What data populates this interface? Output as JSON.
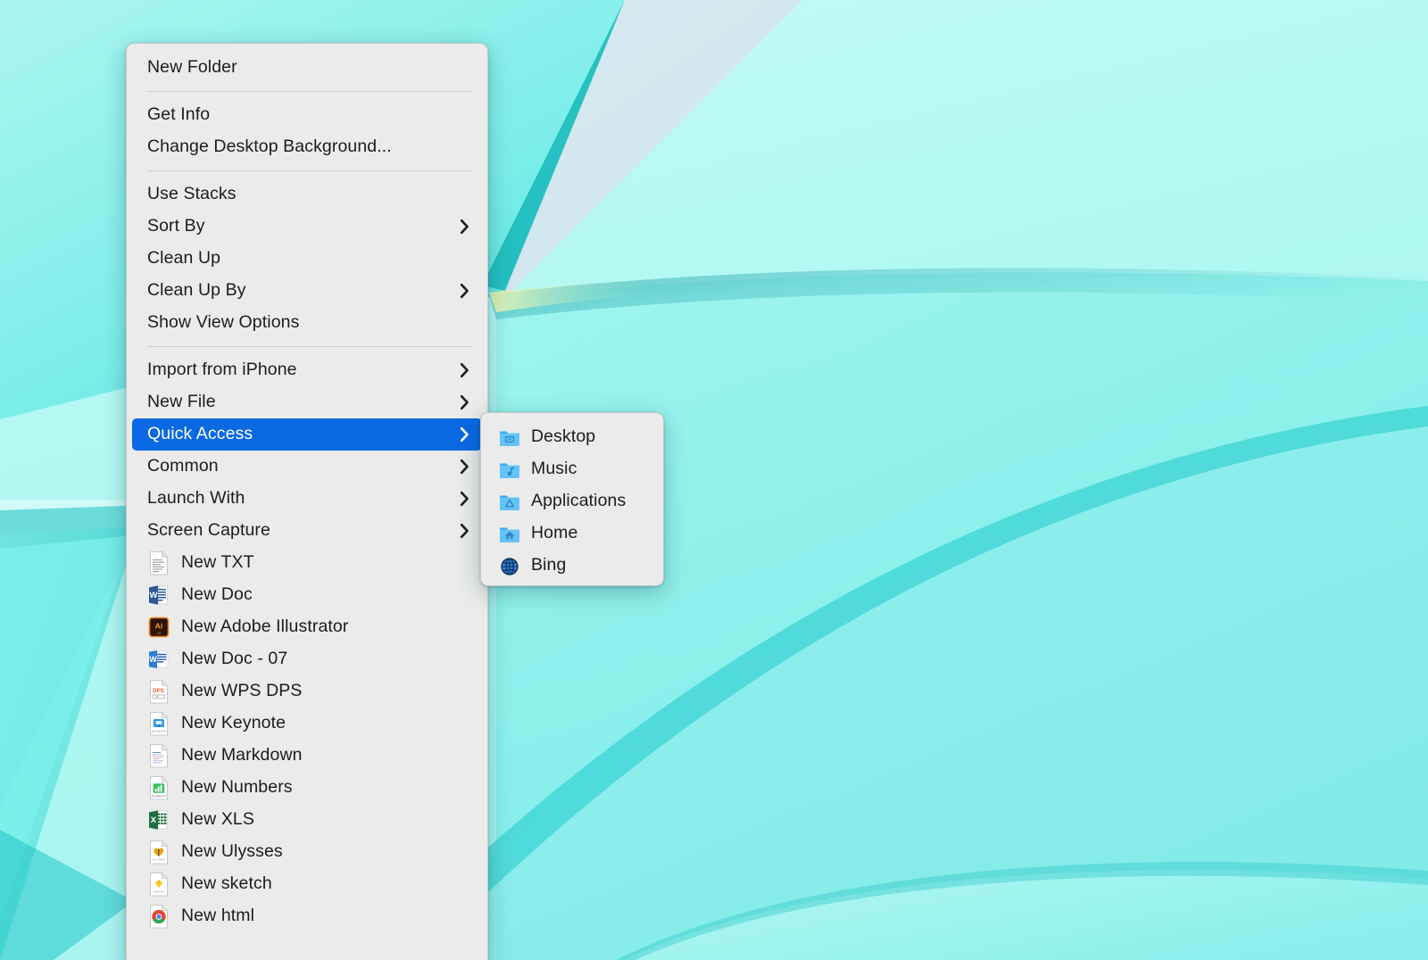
{
  "desktop": {
    "wallpaper_name": "abstract-turquoise-wallpaper",
    "colors": {
      "cyan_light": "#c2fbf5",
      "cyan_mid": "#9df3ec",
      "teal": "#2fd4cd",
      "teal_deep": "#11b8b8",
      "pale_blue": "#d3e6ec",
      "accent_yellow": "#d8e9a8"
    }
  },
  "menu": {
    "name": "desktop-context-menu",
    "background": "#ebebeb",
    "highlight_color": "#0b68e3",
    "text_color": "#1c1c1e",
    "groups": [
      {
        "items": [
          {
            "label": "New Folder",
            "submenu": false,
            "icon": null
          }
        ]
      },
      {
        "items": [
          {
            "label": "Get Info",
            "submenu": false,
            "icon": null
          },
          {
            "label": "Change Desktop Background...",
            "submenu": false,
            "icon": null
          }
        ]
      },
      {
        "items": [
          {
            "label": "Use Stacks",
            "submenu": false,
            "icon": null
          },
          {
            "label": "Sort By",
            "submenu": true,
            "icon": null
          },
          {
            "label": "Clean Up",
            "submenu": false,
            "icon": null
          },
          {
            "label": "Clean Up By",
            "submenu": true,
            "icon": null
          },
          {
            "label": "Show View Options",
            "submenu": false,
            "icon": null
          }
        ]
      },
      {
        "items": [
          {
            "label": "Import from iPhone",
            "submenu": true,
            "icon": null,
            "selected": false
          },
          {
            "label": "New File",
            "submenu": true,
            "icon": null,
            "selected": false
          },
          {
            "label": "Quick Access",
            "submenu": true,
            "icon": null,
            "selected": true
          },
          {
            "label": "Common",
            "submenu": true,
            "icon": null,
            "selected": false
          },
          {
            "label": "Launch With",
            "submenu": true,
            "icon": null,
            "selected": false
          },
          {
            "label": "Screen Capture",
            "submenu": true,
            "icon": null,
            "selected": false
          },
          {
            "label": "New TXT",
            "submenu": false,
            "icon": "txt-document-icon"
          },
          {
            "label": "New Doc",
            "submenu": false,
            "icon": "word-doc-icon"
          },
          {
            "label": "New Adobe Illustrator",
            "submenu": false,
            "icon": "adobe-illustrator-icon"
          },
          {
            "label": "New Doc - 07",
            "submenu": false,
            "icon": "word-docx-icon"
          },
          {
            "label": "New WPS DPS",
            "submenu": false,
            "icon": "wps-dps-icon"
          },
          {
            "label": "New Keynote",
            "submenu": false,
            "icon": "keynote-icon"
          },
          {
            "label": "New Markdown",
            "submenu": false,
            "icon": "markdown-document-icon"
          },
          {
            "label": "New Numbers",
            "submenu": false,
            "icon": "numbers-icon"
          },
          {
            "label": "New XLS",
            "submenu": false,
            "icon": "excel-xls-icon"
          },
          {
            "label": "New Ulysses",
            "submenu": false,
            "icon": "ulysses-icon"
          },
          {
            "label": "New sketch",
            "submenu": false,
            "icon": "sketch-icon"
          },
          {
            "label": "New html",
            "submenu": false,
            "icon": "chrome-html-icon"
          }
        ]
      }
    ]
  },
  "submenu": {
    "name": "quick-access-submenu",
    "parent_item": "Quick Access",
    "items": [
      {
        "label": "Desktop",
        "icon": "folder-desktop-icon"
      },
      {
        "label": "Music",
        "icon": "folder-music-icon"
      },
      {
        "label": "Applications",
        "icon": "folder-applications-icon"
      },
      {
        "label": "Home",
        "icon": "folder-home-icon"
      },
      {
        "label": "Bing",
        "icon": "globe-bing-icon"
      }
    ]
  }
}
